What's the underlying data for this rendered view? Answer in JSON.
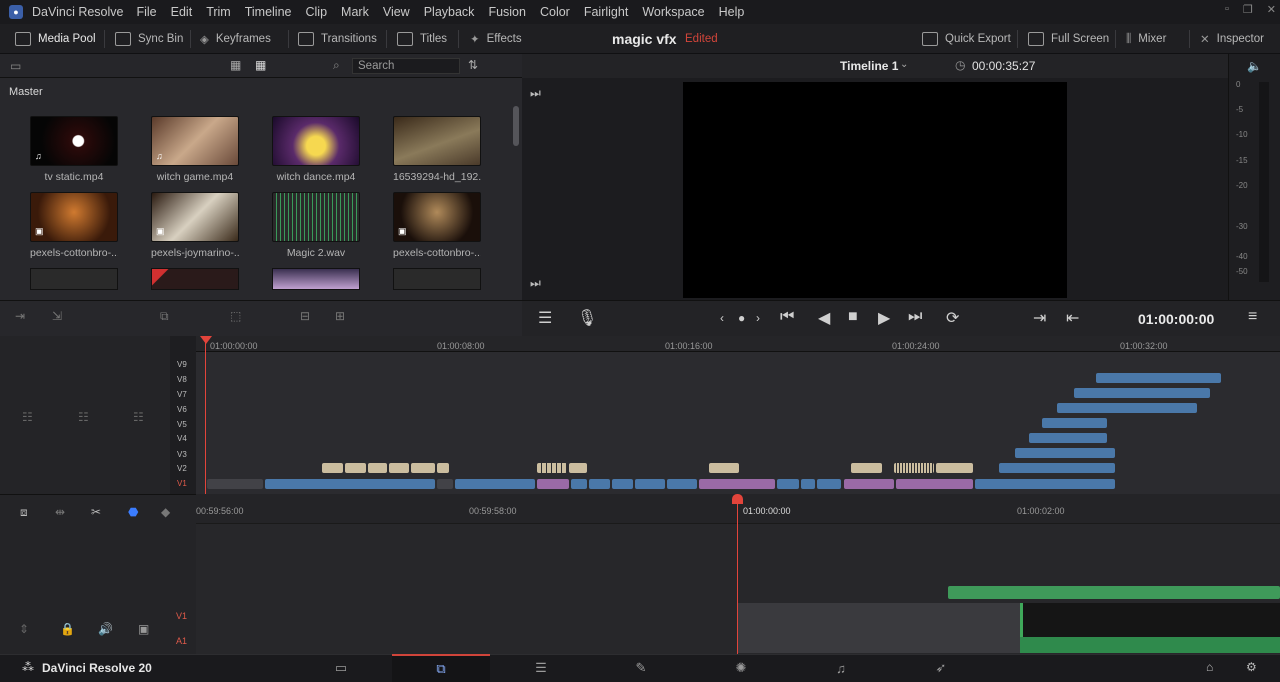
{
  "menubar": {
    "app": "DaVinci Resolve",
    "items": [
      "File",
      "Edit",
      "Trim",
      "Timeline",
      "Clip",
      "Mark",
      "View",
      "Playback",
      "Fusion",
      "Color",
      "Fairlight",
      "Workspace",
      "Help"
    ]
  },
  "toolbar": {
    "media_pool": "Media Pool",
    "sync_bin": "Sync Bin",
    "keyframes": "Keyframes",
    "transitions": "Transitions",
    "titles": "Titles",
    "effects": "Effects",
    "project": "magic vfx",
    "edited": "Edited",
    "quick_export": "Quick Export",
    "full_screen": "Full Screen",
    "mixer": "Mixer",
    "inspector": "Inspector"
  },
  "mediapool": {
    "search_placeholder": "Search",
    "bin": "Master",
    "clips": [
      {
        "name": "tv static.mp4"
      },
      {
        "name": "witch game.mp4"
      },
      {
        "name": "witch dance.mp4"
      },
      {
        "name": "16539294-hd_192..."
      },
      {
        "name": "pexels-cottonbro-..."
      },
      {
        "name": "pexels-joymarino-..."
      },
      {
        "name": "Magic 2.wav"
      },
      {
        "name": "pexels-cottonbro-..."
      }
    ]
  },
  "viewer": {
    "timeline": "Timeline 1",
    "timecode": "00:00:35:27",
    "record_tc": "01:00:00:00"
  },
  "meters": [
    "0",
    "-5",
    "-10",
    "-15",
    "-20",
    "-30",
    "-40",
    "-50"
  ],
  "upper_timeline": {
    "ruler": [
      "01:00:00:00",
      "01:00:08:00",
      "01:00:16:00",
      "01:00:24:00",
      "01:00:32:00"
    ],
    "tracks": [
      "V9",
      "V8",
      "V7",
      "V6",
      "V5",
      "V4",
      "V3",
      "V2",
      "V1"
    ]
  },
  "lower_timeline": {
    "ruler": [
      "00:59:56:00",
      "00:59:58:00",
      "01:00:00:00",
      "01:00:02:00"
    ],
    "tracks": [
      "V1",
      "A1"
    ]
  },
  "brand": "DaVinci Resolve 20"
}
